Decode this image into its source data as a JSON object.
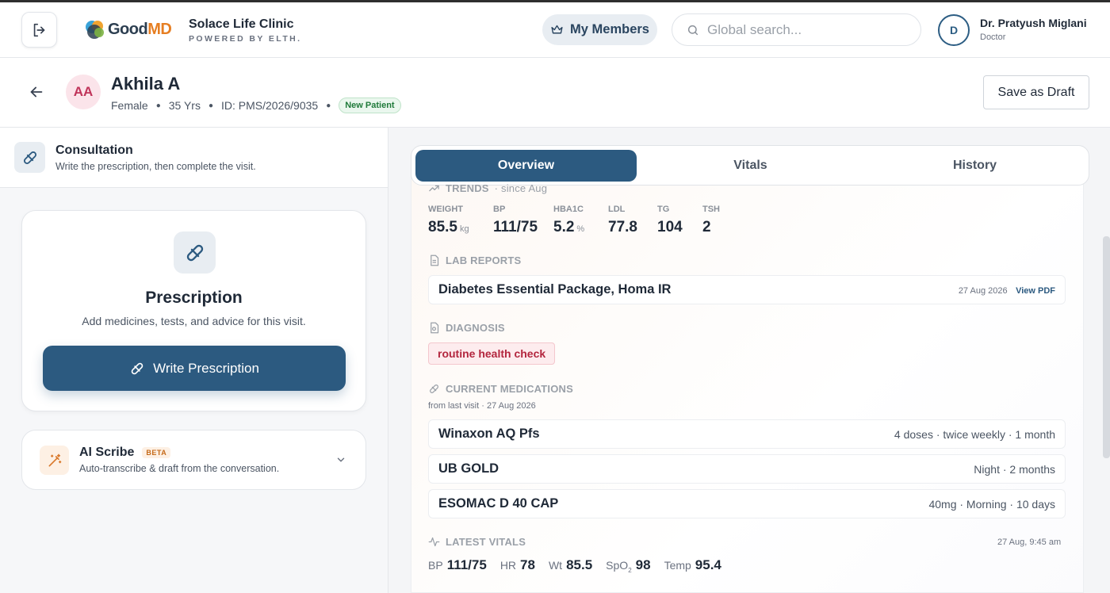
{
  "header": {
    "logo_good": "Good",
    "logo_md": "MD",
    "clinic_name": "Solace Life Clinic",
    "clinic_sub": "POWERED BY ELTH.",
    "members_label": "My Members",
    "search_placeholder": "Global search...",
    "avatar_initial": "D",
    "doctor_name": "Dr. Pratyush Miglani",
    "doctor_role": "Doctor"
  },
  "patient": {
    "initials": "AA",
    "name": "Akhila A",
    "gender": "Female",
    "age": "35 Yrs",
    "id": "ID: PMS/2026/9035",
    "badge": "New Patient",
    "save_draft": "Save as Draft"
  },
  "left": {
    "consult_title": "Consultation",
    "consult_sub": "Write the prescription, then complete the visit.",
    "rx_title": "Prescription",
    "rx_sub": "Add medicines, tests, and advice for this visit.",
    "rx_button": "Write Prescription",
    "scribe_title": "AI Scribe",
    "scribe_badge": "BETA",
    "scribe_sub": "Auto-transcribe & draft from the conversation."
  },
  "tabs": [
    "Overview",
    "Vitals",
    "History"
  ],
  "trends": {
    "title": "TRENDS",
    "since": "· since Aug",
    "metrics": [
      {
        "label": "WEIGHT",
        "value": "85.5",
        "unit": "kg"
      },
      {
        "label": "BP",
        "value": "111/75",
        "unit": ""
      },
      {
        "label": "HBA1C",
        "value": "5.2",
        "unit": "%"
      },
      {
        "label": "LDL",
        "value": "77.8",
        "unit": ""
      },
      {
        "label": "TG",
        "value": "104",
        "unit": ""
      },
      {
        "label": "TSH",
        "value": "2",
        "unit": ""
      }
    ]
  },
  "lab": {
    "title": "LAB REPORTS",
    "name": "Diabetes Essential Package, Homa IR",
    "date": "27 Aug 2026",
    "view": "View PDF"
  },
  "diagnosis": {
    "title": "DIAGNOSIS",
    "chip": "routine health check"
  },
  "medications": {
    "title": "CURRENT MEDICATIONS",
    "sub": "from last visit · 27 Aug 2026",
    "items": [
      {
        "name": "Winaxon AQ Pfs",
        "detail": "4 doses · twice weekly · 1 month"
      },
      {
        "name": "UB GOLD",
        "detail": "Night · 2 months"
      },
      {
        "name": "ESOMAC D 40 CAP",
        "detail": "40mg · Morning · 10 days"
      }
    ]
  },
  "vitals": {
    "title": "LATEST VITALS",
    "date": "27 Aug, 9:45 am",
    "bp_k": "BP",
    "bp_v": "111/75",
    "hr_k": "HR",
    "hr_v": "78",
    "wt_k": "Wt",
    "wt_v": "85.5",
    "spo_k": "SpO",
    "spo_sub": "2",
    "spo_v": "98",
    "temp_k": "Temp",
    "temp_v": "95.4"
  },
  "colors": {
    "primary": "#2c5a80",
    "accent": "#e67e22",
    "danger": "#b3263e"
  }
}
